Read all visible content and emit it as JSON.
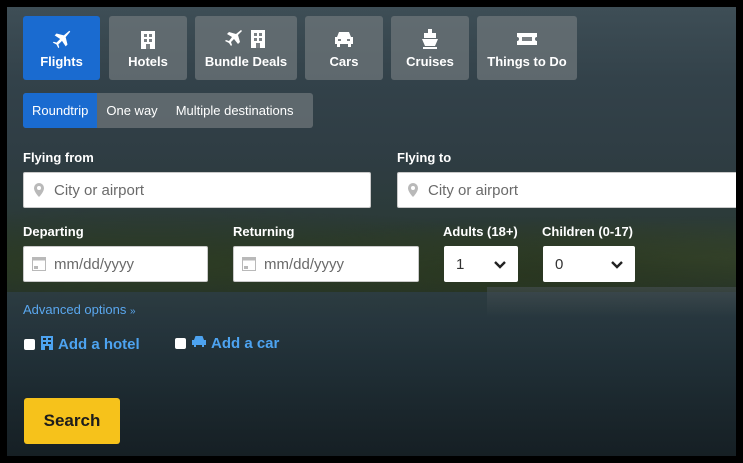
{
  "tabs": [
    {
      "label": "Flights",
      "icon": "airplane-icon",
      "active": true
    },
    {
      "label": "Hotels",
      "icon": "hotel-icon"
    },
    {
      "label": "Bundle Deals",
      "icon": "bundle-icon"
    },
    {
      "label": "Cars",
      "icon": "car-icon"
    },
    {
      "label": "Cruises",
      "icon": "ship-icon"
    },
    {
      "label": "Things to Do",
      "icon": "ticket-icon"
    }
  ],
  "trip_types": [
    {
      "label": "Roundtrip",
      "active": true
    },
    {
      "label": "One way"
    },
    {
      "label": "Multiple destinations"
    }
  ],
  "flying_from": {
    "label": "Flying from",
    "placeholder": "City or airport"
  },
  "flying_to": {
    "label": "Flying to",
    "placeholder": "City or airport"
  },
  "departing": {
    "label": "Departing",
    "placeholder": "mm/dd/yyyy"
  },
  "returning": {
    "label": "Returning",
    "placeholder": "mm/dd/yyyy"
  },
  "adults": {
    "label": "Adults (18+)",
    "value": "1"
  },
  "children": {
    "label": "Children (0-17)",
    "value": "0"
  },
  "advanced_options": "Advanced options",
  "add_hotel": "Add a hotel",
  "add_car": "Add a car",
  "search_label": "Search",
  "colors": {
    "accent": "#1a6bd0",
    "search": "#f6c21b",
    "link": "#4da3f0"
  }
}
